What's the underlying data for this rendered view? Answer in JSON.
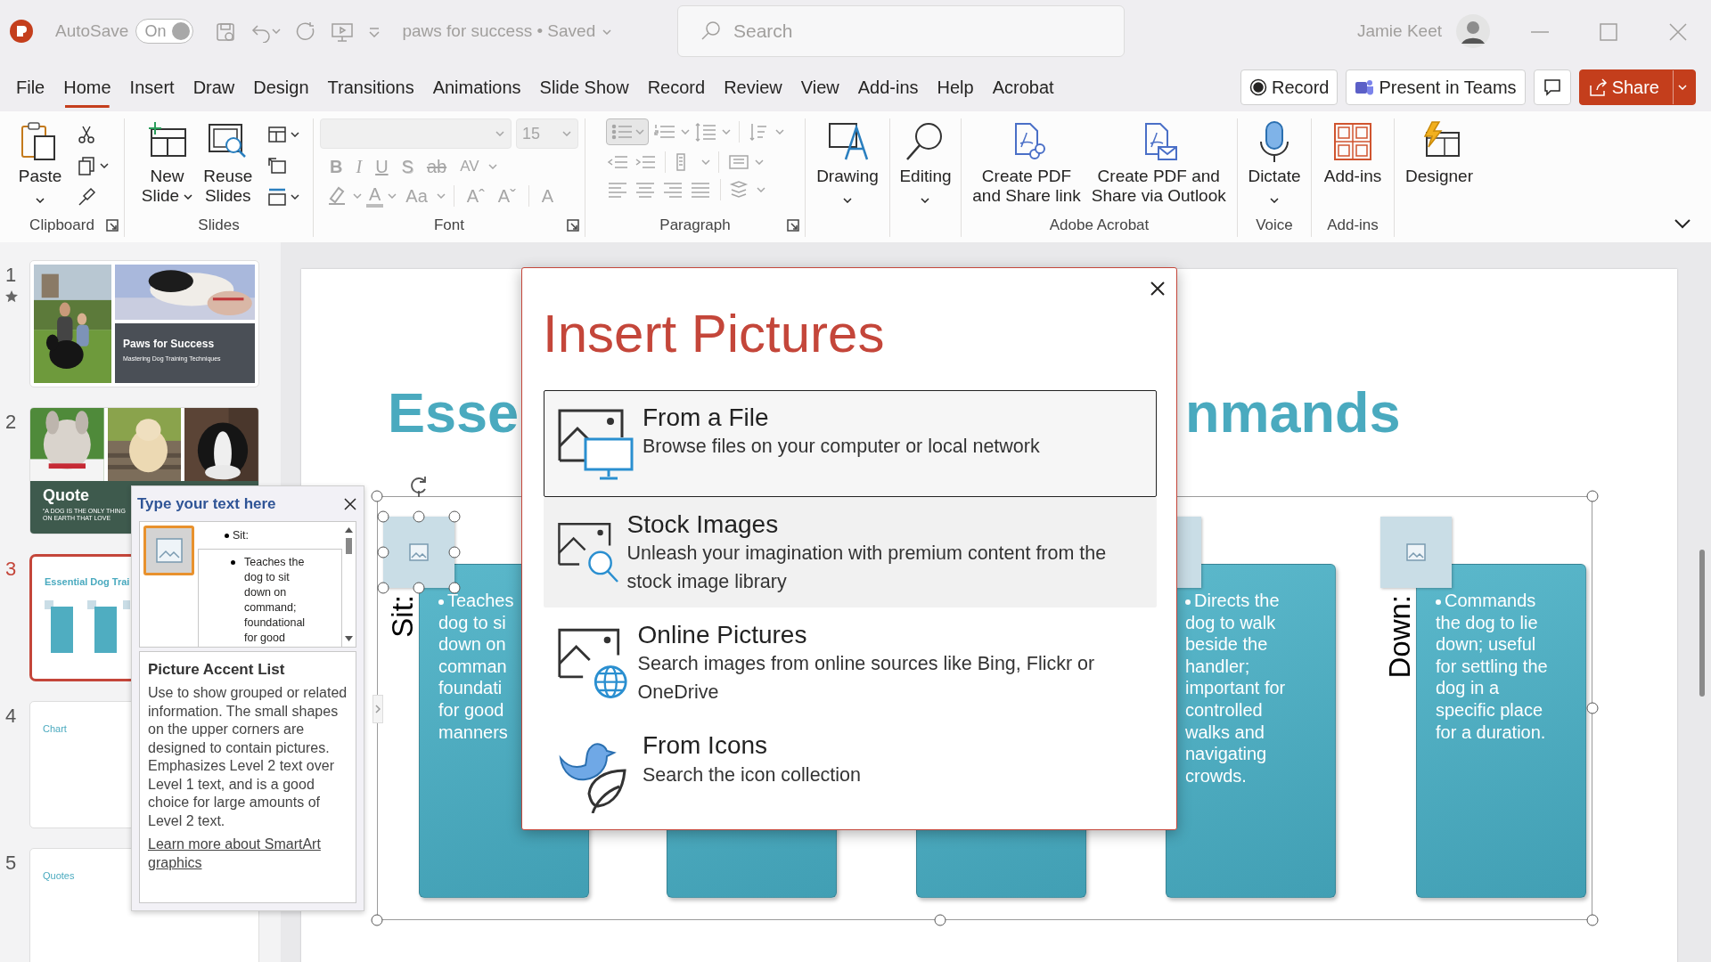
{
  "title_bar": {
    "autosave_label": "AutoSave",
    "autosave_toggle": {
      "label": "On",
      "on": true
    },
    "document_title": "paws for success • Saved",
    "search": {
      "placeholder": "Search"
    },
    "user_name": "Jamie Keet"
  },
  "ribbon_tabs": [
    {
      "label": "File",
      "selected": false
    },
    {
      "label": "Home",
      "selected": true
    },
    {
      "label": "Insert",
      "selected": false
    },
    {
      "label": "Draw",
      "selected": false
    },
    {
      "label": "Design",
      "selected": false
    },
    {
      "label": "Transitions",
      "selected": false
    },
    {
      "label": "Animations",
      "selected": false
    },
    {
      "label": "Slide Show",
      "selected": false
    },
    {
      "label": "Record",
      "selected": false
    },
    {
      "label": "Review",
      "selected": false
    },
    {
      "label": "View",
      "selected": false
    },
    {
      "label": "Add-ins",
      "selected": false
    },
    {
      "label": "Help",
      "selected": false
    },
    {
      "label": "Acrobat",
      "selected": false
    }
  ],
  "ribbon_actions": [
    {
      "kind": "record",
      "label": "Record"
    },
    {
      "kind": "teams",
      "label": "Present in Teams"
    },
    {
      "kind": "comments"
    },
    {
      "kind": "share",
      "label": "Share"
    }
  ],
  "ribbon_groups": [
    {
      "kind": "clipboard",
      "label": "Clipboard",
      "launcher": true,
      "buttons": [
        {
          "label": "Paste",
          "dropdown": true
        }
      ]
    },
    {
      "kind": "slides",
      "label": "Slides",
      "buttons": [
        {
          "label": "New\nSlide",
          "dropdown": true
        },
        {
          "label": "Reuse\nSlides",
          "dropdown": false
        }
      ]
    },
    {
      "kind": "font",
      "label": "Font",
      "launcher": true,
      "disabled": true,
      "font_size": "15",
      "glyphs": [
        "B",
        "I",
        "U",
        "S",
        "ab",
        "AV"
      ],
      "glyphs_row_2": [
        "A",
        "Aa",
        "Aˆ",
        "Aˇ",
        "A"
      ]
    },
    {
      "kind": "paragraph",
      "label": "Paragraph",
      "launcher": true,
      "disabled": true,
      "bullets_selected": true
    },
    {
      "kind": "drawing",
      "buttons": [
        {
          "label": "Drawing",
          "dropdown": true
        }
      ]
    },
    {
      "kind": "editing",
      "buttons": [
        {
          "label": "Editing",
          "dropdown": true
        }
      ]
    },
    {
      "kind": "acrobat",
      "label": "Adobe Acrobat",
      "buttons": [
        {
          "label": "Create PDF\nand Share link",
          "dropdown": false
        },
        {
          "label": "Create PDF and\nShare via Outlook",
          "dropdown": false
        }
      ]
    },
    {
      "kind": "voice",
      "label": "Voice",
      "buttons": [
        {
          "label": "Dictate",
          "dropdown": true
        }
      ]
    },
    {
      "kind": "addins",
      "label": "Add-ins",
      "buttons": [
        {
          "label": "Add-ins",
          "dropdown": false
        }
      ]
    },
    {
      "kind": "designer",
      "buttons": [
        {
          "label": "Designer",
          "dropdown": false
        }
      ]
    }
  ],
  "slides": [
    {
      "number": "1",
      "selected": false,
      "has_transition": true,
      "kind": "title",
      "title": "Paws for Success",
      "subtitle": "Mastering Dog Training Techniques"
    },
    {
      "number": "2",
      "selected": false,
      "kind": "quote",
      "title": "Quote",
      "subtitle": "“A DOG IS THE ONLY THING ON EARTH THAT LOVE"
    },
    {
      "number": "3",
      "selected": true,
      "kind": "columns",
      "title": "Essential Dog Trai"
    },
    {
      "number": "4",
      "selected": false,
      "kind": "blank",
      "title": "Chart"
    },
    {
      "number": "5",
      "selected": false,
      "kind": "blank",
      "title": "Quotes"
    }
  ],
  "text_pane": {
    "title": "Type your text here",
    "picture_selected": true,
    "bullets": [
      {
        "text": "Sit:",
        "children": [
          {
            "text": "Teaches the dog to sit down on command; foundational for good"
          }
        ]
      }
    ],
    "layout_name": "Picture Accent List",
    "description": "Use to show grouped or related information. The small shapes on the upper corners are designed to contain pictures. Emphasizes Level 2 text over Level 1 text, and is a good choice for large amounts of Level 2 text.",
    "link": "Learn more about SmartArt graphics"
  },
  "slide": {
    "title_left": "Esse",
    "title_right": "nmands",
    "columns": [
      {
        "kind": "left",
        "label": "Sit:",
        "picture_selected": true,
        "lines": [
          "Teaches",
          "dog to si",
          "down on",
          "comman",
          "foundati",
          "for good",
          "manners"
        ]
      },
      {
        "kind": "covered"
      },
      {
        "kind": "covered"
      },
      {
        "kind": "right",
        "text": "Directs the dog to walk beside the handler; important for controlled walks and navigating crowds."
      },
      {
        "kind": "full",
        "label": "Down:",
        "text": "Commands the dog to lie down; useful for settling the dog in a specific place for a duration."
      }
    ]
  },
  "dialog": {
    "title": "Insert Pictures",
    "options": [
      {
        "title": "From a File",
        "description": "Browse files on your computer or local network",
        "selected": true,
        "highlighted": false
      },
      {
        "title": "Stock Images",
        "description": "Unleash your imagination with premium content from the stock image library",
        "selected": false,
        "highlighted": true
      },
      {
        "title": "Online Pictures",
        "description": "Search images from online sources like Bing, Flickr or OneDrive",
        "selected": false,
        "highlighted": false
      },
      {
        "title": "From Icons",
        "description": "Search the icon collection",
        "selected": false,
        "highlighted": false
      }
    ]
  }
}
